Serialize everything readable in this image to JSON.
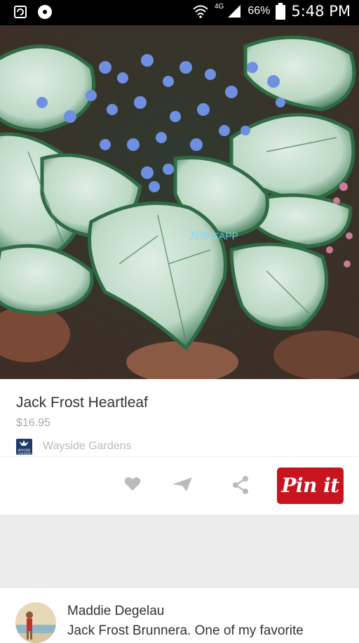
{
  "status_bar": {
    "network": "4G",
    "battery_percent": "66%",
    "time": "5:48 PM"
  },
  "hero": {
    "watermark": "万物本APP"
  },
  "pin": {
    "title": "Jack Frost Heartleaf",
    "price": "$16.95",
    "source_name": "Wayside Gardens",
    "source_logo_text": "WAYSIDE GARDENS"
  },
  "actions": {
    "pin_button_label": "Pin it",
    "icons": [
      "heart-icon",
      "send-icon",
      "share-icon"
    ]
  },
  "comment": {
    "author": "Maddie Degelau",
    "text": "Jack Frost Brunnera. One of my favorite"
  },
  "colors": {
    "pin_button": "#c8141e",
    "text_primary": "#333333",
    "text_muted": "#aaaaaa",
    "separator_gray": "#ececec"
  }
}
